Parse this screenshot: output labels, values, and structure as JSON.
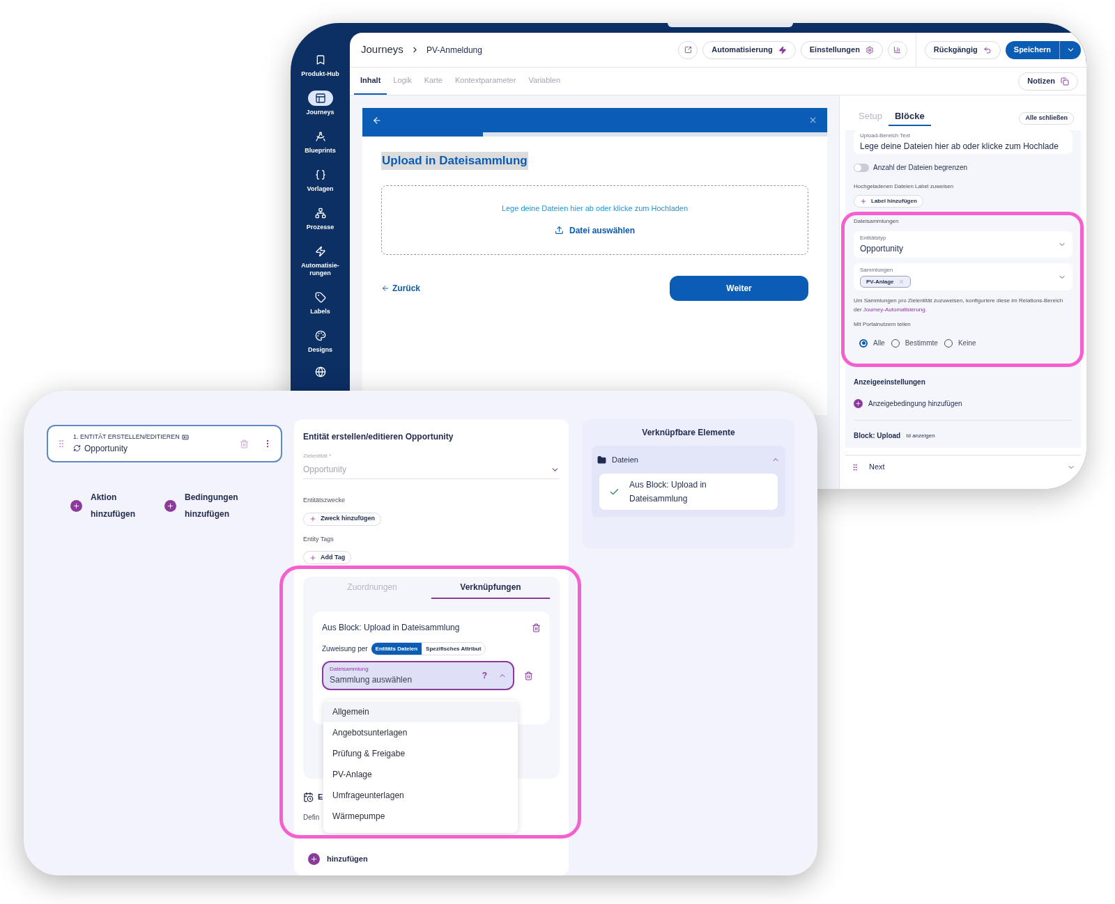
{
  "back_window": {
    "sidebar": {
      "items": [
        {
          "label": "Produkt-Hub",
          "selected": false
        },
        {
          "label": "Journeys",
          "selected": true
        },
        {
          "label": "Blueprints",
          "selected": false
        },
        {
          "label": "Vorlagen",
          "selected": false
        },
        {
          "label": "Prozesse",
          "selected": false
        },
        {
          "label": "Automatisie-rungen",
          "selected": false
        },
        {
          "label": "Labels",
          "selected": false
        },
        {
          "label": "Designs",
          "selected": false
        }
      ]
    },
    "breadcrumb": [
      "Journeys",
      "PV-Anmeldung"
    ],
    "toolbar": {
      "automation": "Automatisierung",
      "settings": "Einstellungen",
      "undo": "Rückgängig",
      "save": "Speichern"
    },
    "tabs": [
      {
        "label": "Inhalt",
        "selected": true
      },
      {
        "label": "Logik",
        "selected": false
      },
      {
        "label": "Karte",
        "selected": false
      },
      {
        "label": "Kontextparameter",
        "selected": false
      },
      {
        "label": "Variablen",
        "selected": false
      }
    ],
    "notes_button": "Notizen",
    "preview": {
      "progress": {
        "level": 0.26
      },
      "title": "Upload in Dateisammlung",
      "dropzone": {
        "hint": "Lege deine Dateien hier ab oder klicke zum Hochladen",
        "button": "Datei auswählen"
      },
      "back_link": "Zurück",
      "next_button": "Weiter"
    },
    "panel": {
      "tabs": [
        {
          "label": "Setup",
          "selected": false
        },
        {
          "label": "Blöcke",
          "selected": true
        }
      ],
      "collapse_button": "Alle schließen",
      "upload_text_field": {
        "label": "Upload-Bereich Text",
        "value": "Lege deine Dateien hier ab oder klicke zum Hochlade"
      },
      "limit_toggle": {
        "label": "Anzahl der Dateien begrenzen",
        "on": false
      },
      "label_section": {
        "label": "Hochgeladenen Dateien Label zuweisen",
        "button": "Label hinzufügen"
      },
      "collections": {
        "heading": "Dateisammlungen",
        "entity_type": {
          "label": "Entitätstyp",
          "value": "Opportunity"
        },
        "collections_field": {
          "label": "Sammlungen",
          "chips": [
            "PV-Anlage"
          ]
        },
        "help_text": "Um Sammlungen pro Zielentität zuzuweisen, konfiguriere diese im Relations-Bereich der ",
        "help_link": "Journey-Automatisierung.",
        "share": {
          "label": "Mit Portalnutzern teilen",
          "options": [
            {
              "label": "Alle",
              "selected": true
            },
            {
              "label": "Bestimmte",
              "selected": false
            },
            {
              "label": "Keine",
              "selected": false
            }
          ]
        }
      },
      "display": {
        "heading": "Anzeigeeinstellungen",
        "add_condition": "Anzeigebedingung hinzufügen"
      },
      "block_info": {
        "title": "Block: Upload",
        "link": "Id anzeigen"
      },
      "next_row": "Next"
    }
  },
  "front_window": {
    "node_card": {
      "step": "1. ENTITÄT ERSTELLEN/EDITIEREN",
      "entity": "Opportunity"
    },
    "add_actions": [
      {
        "line1": "Aktion",
        "line2": "hinzufügen"
      },
      {
        "line1": "Bedingungen",
        "line2": "hinzufügen"
      }
    ],
    "editor": {
      "title": "Entität erstellen/editieren Opportunity",
      "target_field": {
        "label": "Zielentität *",
        "value": "Opportunity",
        "disabled": true
      },
      "purposes": {
        "label": "Entitätszwecke",
        "button": "Zweck hinzufügen"
      },
      "tags": {
        "label": "Entity Tags",
        "button": "Add Tag"
      },
      "tabs": [
        {
          "label": "Zuordnungen",
          "selected": false
        },
        {
          "label": "Verknüpfungen",
          "selected": true
        }
      ],
      "link_card": {
        "title": "Aus Block: Upload in Dateisammlung",
        "assign_label": "Zuweisung per",
        "assign_options": [
          {
            "label": "Entitäts Dateien",
            "selected": true
          },
          {
            "label": "Spezifisches Attribut",
            "selected": false
          }
        ],
        "select": {
          "label": "Dateisammlung",
          "placeholder": "Sammlung auswählen",
          "help": "?",
          "expanded": true
        }
      },
      "dropdown": [
        {
          "label": "Allgemein",
          "highlighted": true
        },
        {
          "label": "Angebotsunterlagen",
          "highlighted": false
        },
        {
          "label": "Prüfung & Freigabe",
          "highlighted": false
        },
        {
          "label": "PV-Anlage",
          "highlighted": false
        },
        {
          "label": "Umfrageunterlagen",
          "highlighted": false
        },
        {
          "label": "Wärmepumpe",
          "highlighted": false
        }
      ],
      "hidden_row": "E",
      "hidden_text": "Defin",
      "add_time": "hinzufügen"
    },
    "linkable": {
      "title": "Verknüpfbare Elemente",
      "group": {
        "label": "Dateien",
        "expanded": true,
        "items": [
          "Aus Block: Upload in Dateisammlung"
        ]
      }
    }
  }
}
